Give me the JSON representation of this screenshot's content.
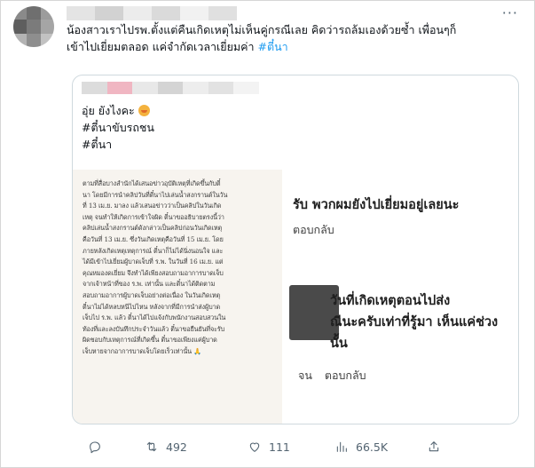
{
  "tweet": {
    "more_label": "···",
    "text_line1": "น้องสาวเราไปรพ.ตั้งแต่คืนเกิดเหตุไม่เห็นคู่กรณีเลย คิดว่ารถล้มเองด้วยซ้ำ เพื่อนๆก็",
    "text_line2": "เข้าไปเยี่ยมตลอด แค่จำกัดเวลาเยี่ยมค่า ",
    "hashtag": "#ตี๋นา"
  },
  "quoted": {
    "line1": "อุ่ย ยังไงคะ",
    "line2": "#ตี๋นาขับรถชน",
    "line3": "#ตี๋นา",
    "image_left": {
      "lines": [
        "ตามที่สื่อบางสำนักได้เสนอข่าวอุบัติเหตุที่เกิดขึ้นกับตี๋",
        "นา โดยมีการนำคลิปวันที่ตี๋นาไปเล่นน้ำสงกรานต์ในวัน",
        "ที่ 13 เม.ย. มาลง แล้วเสนอข่าวว่าเป็นคลิปในวันเกิด",
        "เหตุ จนทำให้เกิดการเข้าใจผิด ตี๋นาขออธิบายตรงนี้ว่า",
        "คลิปเล่นน้ำสงกรานต์ดังกล่าวเป็นคลิปก่อนวันเกิดเหตุ",
        "คือวันที่ 13 เม.ย. ซึ่งวันเกิดเหตุคือวันที่ 15 เม.ย. โดย",
        "ภายหลังเกิดเหตุเหตุการณ์ ตี๋นาก็ไม่ได้นิ่งนอนใจ และ",
        "ได้มีเข้าไปเยี่ยมผู้บาดเจ็บที่ ร.พ. ในวันที่ 16 เม.ย. แต่",
        "คุณหมองดเยี่ยม จึงทำได้เพียงสอบถามอาการบาดเจ็บ",
        "จากเจ้าหน้าที่ของ ร.พ. เท่านั้น และตี๋นาได้ติดตาม",
        "สอบถามอาการผู้บาดเจ็บอย่างต่อเนื่อง ในวันเกิดเหตุ",
        "ตี๋นาไม่ได้หลบหนีไปไหน หลังจากที่มีการนำส่งผู้บาด",
        "เจ็บไป ร.พ. แล้ว ตี๋นาได้ไปแจ้งกับพนักงานสอบสวนใน",
        "ท้องที่และลงบันทึกประจำวันแล้ว ตี๋นาขอยืนยันที่จะรับ",
        "ผิดชอบกับเหตุการณ์ที่เกิดขึ้น ตี๋นาขอเพียงแค่ผู้บาด",
        "เจ็บหายจากอาการบาดเจ็บโดยเร็วเท่านั้น 🙏"
      ]
    },
    "image_right": {
      "line1": "รับ พวกผมยังไปเยี่ยมอยู่เลยนะ",
      "reply1": "ตอบกลับ",
      "line2": "วันที่เกิดเหตุตอนไปส่ง",
      "line3": "ณีนะครับเท่าที่รู้มา เห็นแค่ช่วง",
      "line4": "นั้น",
      "reply2_prefix": "จน",
      "reply2": "ตอบกลับ"
    }
  },
  "actions": {
    "reply_count": "",
    "retweet_count": "492",
    "like_count": "111",
    "view_count": "66.5K"
  },
  "colors": {
    "accent": "#1d9bf0",
    "text": "#0f1419",
    "muted": "#536471",
    "border": "#cfd9de"
  },
  "icons": [
    "reply-icon",
    "retweet-icon",
    "like-icon",
    "views-icon",
    "share-icon",
    "more-icon"
  ]
}
